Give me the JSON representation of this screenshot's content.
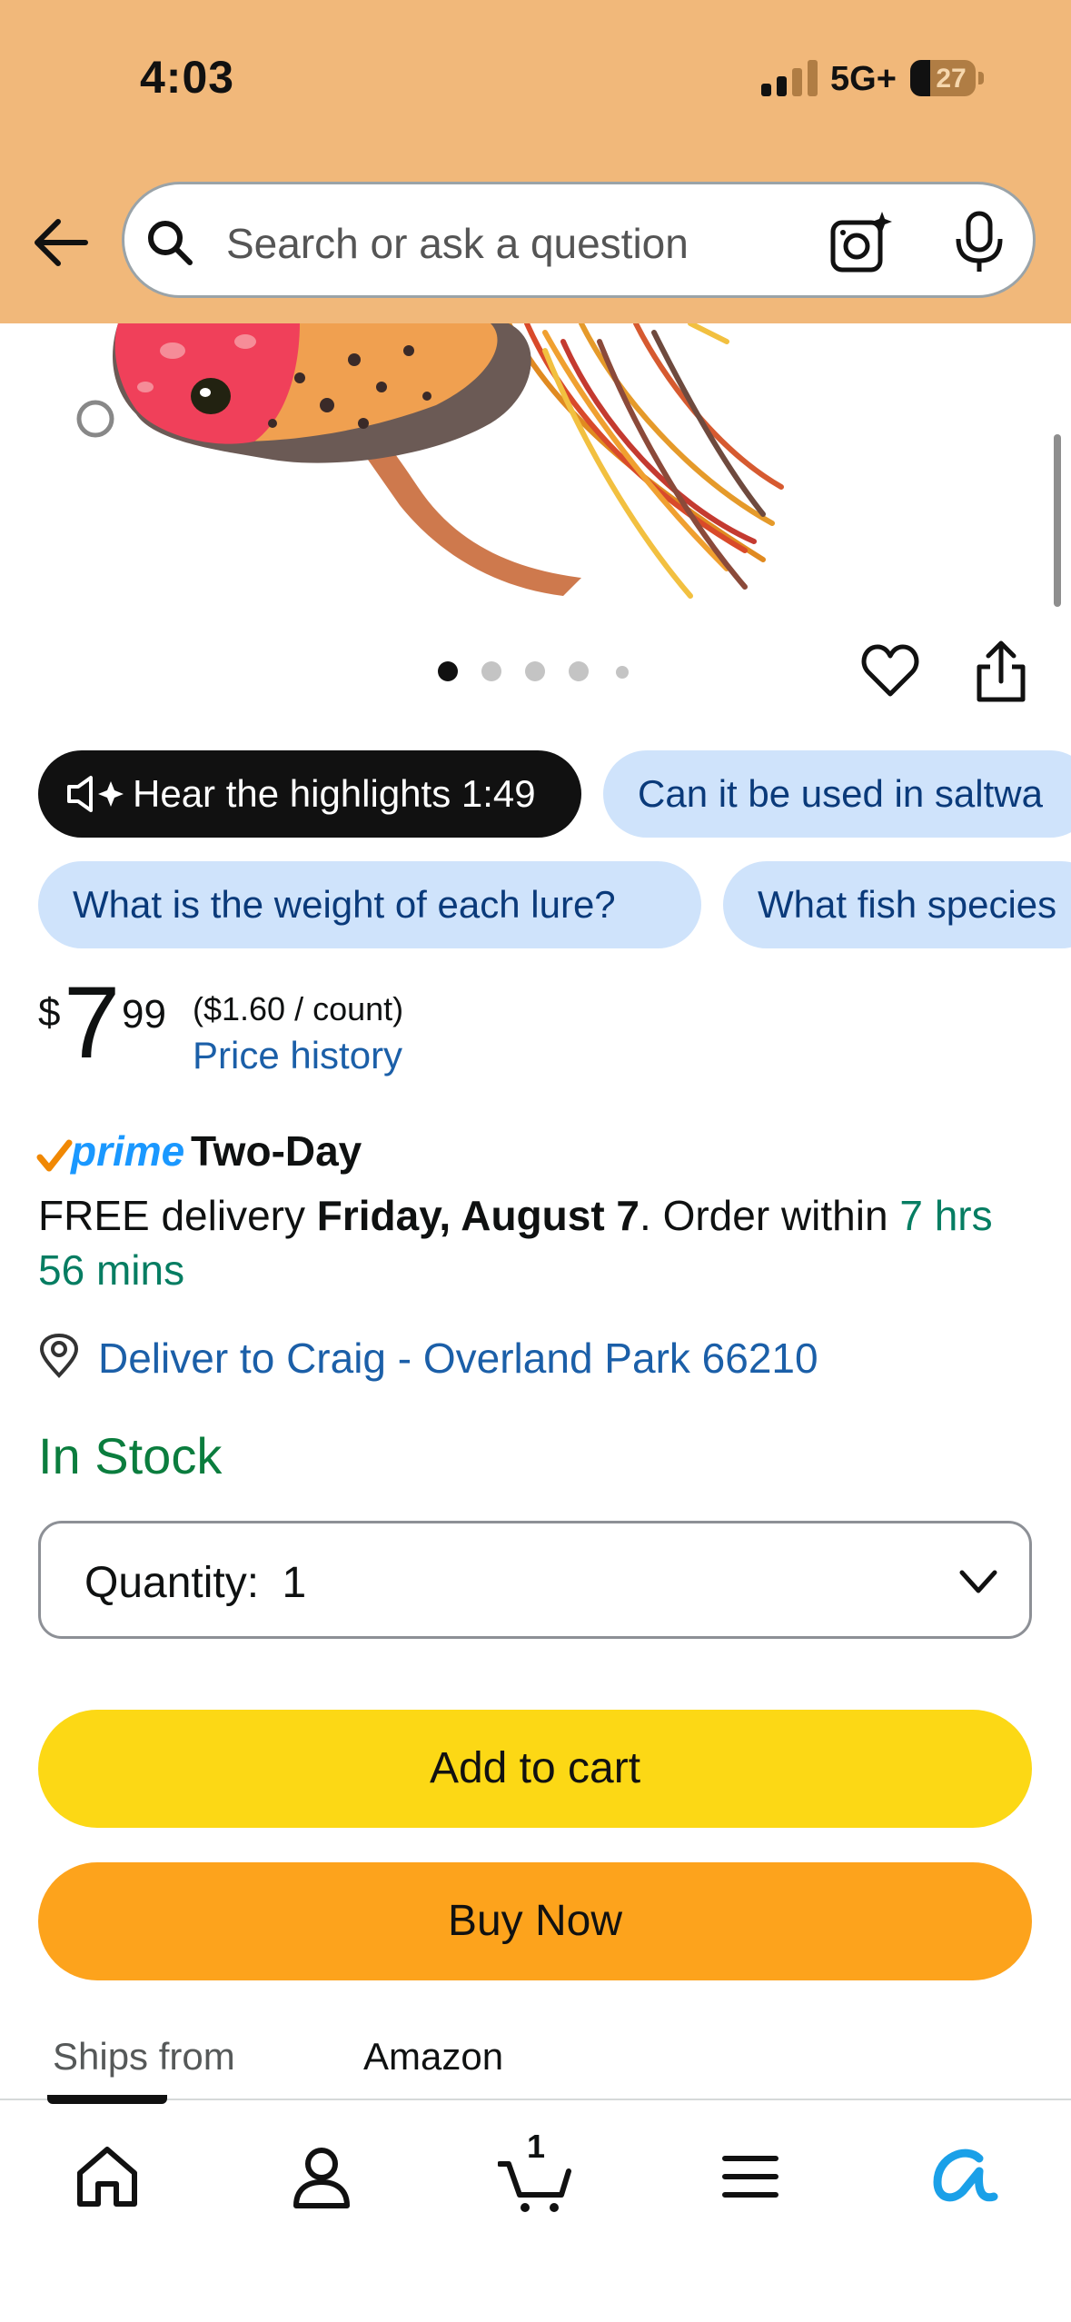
{
  "status_bar": {
    "time": "4:03",
    "network": "5G+",
    "battery": "27"
  },
  "search": {
    "placeholder": "Search or ask a question"
  },
  "gallery": {
    "image_count": 5,
    "active_index": 0
  },
  "chips": {
    "hear_highlights": "Hear the highlights 1:49",
    "q1": "Can it be used in saltwa",
    "q2": "What is the weight of each lure?",
    "q3": "What fish species"
  },
  "price": {
    "currency": "$",
    "whole": "7",
    "fraction": "99",
    "unit_price": "($1.60 / count)",
    "history_link": "Price history"
  },
  "prime": {
    "logo": "prime",
    "label": "Two-Day"
  },
  "delivery": {
    "prefix": "FREE delivery ",
    "date": "Friday, August 7",
    "middle": ". Order within ",
    "countdown": "7 hrs 56 mins"
  },
  "location": {
    "label": "Deliver to Craig - Overland Park 66210"
  },
  "stock": {
    "status": "In Stock"
  },
  "quantity": {
    "label": "Quantity:",
    "value": "1"
  },
  "buttons": {
    "add_to_cart": "Add to cart",
    "buy_now": "Buy Now"
  },
  "ships_from": {
    "label": "Ships from",
    "value": "Amazon"
  },
  "bottom_nav": {
    "cart_count": "1"
  },
  "colors": {
    "header": "#f1b87a",
    "add_to_cart": "#fcd815",
    "buy_now": "#fda31c",
    "link": "#1b5fa8",
    "in_stock": "#0b7d3e",
    "chip_light": "#cfe3fb",
    "prime_blue": "#1a98ff"
  }
}
